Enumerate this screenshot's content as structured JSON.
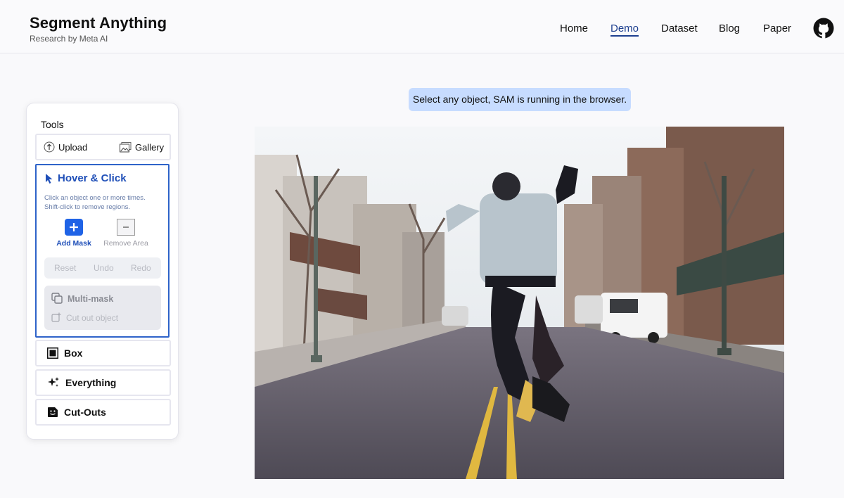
{
  "brand": {
    "title": "Segment Anything",
    "subtitle": "Research by Meta AI"
  },
  "nav": {
    "items": [
      {
        "label": "Home",
        "active": false
      },
      {
        "label": "Demo",
        "active": true
      },
      {
        "label": "Dataset",
        "active": false
      },
      {
        "label": "Blog",
        "active": false
      },
      {
        "label": "Paper",
        "active": false
      }
    ],
    "github_icon": "github-icon"
  },
  "banner": {
    "text": "Select any object, SAM is running in the browser."
  },
  "tools": {
    "title": "Tools",
    "upload_label": "Upload",
    "gallery_label": "Gallery",
    "hover_click": {
      "title": "Hover & Click",
      "description_line1": "Click an object one or more times.",
      "description_line2": "Shift-click to remove regions.",
      "add_mask_label": "Add Mask",
      "remove_area_label": "Remove Area",
      "reset_label": "Reset",
      "undo_label": "Undo",
      "redo_label": "Redo",
      "multimask_label": "Multi-mask",
      "cutout_label": "Cut out object"
    },
    "box_label": "Box",
    "everything_label": "Everything",
    "cutouts_label": "Cut-Outs"
  },
  "colors": {
    "accent": "#1f63e6",
    "accent_text": "#1f4fb8",
    "banner_bg": "#c7dcff",
    "nav_active": "#1d3f8f"
  }
}
